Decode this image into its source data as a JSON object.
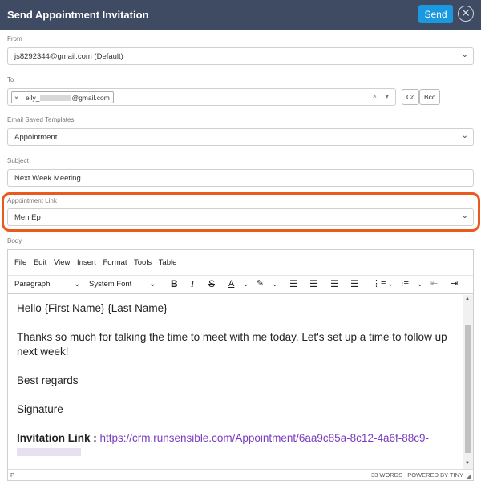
{
  "header": {
    "title": "Send Appointment Invitation",
    "send_label": "Send",
    "close_glyph": "✕"
  },
  "from": {
    "label": "From",
    "value": "js8292344@gmail.com (Default)"
  },
  "to": {
    "label": "To",
    "chip_remove": "×",
    "chip_prefix": "elly_",
    "chip_suffix": "@gmail.com",
    "clear_glyph": "×",
    "dropdown_glyph": "▾",
    "cc_label": "Cc",
    "bcc_label": "Bcc"
  },
  "templates": {
    "label": "Email Saved Templates",
    "value": "Appointment"
  },
  "subject": {
    "label": "Subject",
    "value": "Next Week Meeting"
  },
  "appointment_link": {
    "label": "Appointment Link",
    "value": "Men Ep"
  },
  "body": {
    "label": "Body",
    "menu": [
      "File",
      "Edit",
      "View",
      "Insert",
      "Format",
      "Tools",
      "Table"
    ],
    "toolbar": {
      "block_format": "Paragraph",
      "font_family": "System Font"
    },
    "content": {
      "greeting": "Hello {First Name} {Last Name}",
      "paragraph": "Thanks so much for talking the time to meet with me today. Let's set up a time to follow up next week!",
      "closing": "Best regards",
      "signature": "Signature",
      "invitation_label": "Invitation Link :",
      "invitation_url": "https://crm.runsensible.com/Appointment/6aa9c85a-8c12-4a6f-88c9-"
    },
    "status": {
      "path": "P",
      "word_count": "33 WORDS",
      "powered_by": "POWERED BY TINY"
    }
  },
  "colors": {
    "header_bg": "#3f4a63",
    "send_btn": "#1a98e0",
    "highlight": "#ea5a1e",
    "link": "#7a3cbf"
  },
  "icons": [
    "close-icon",
    "chevron-down-icon",
    "bold-icon",
    "italic-icon",
    "strikethrough-icon",
    "text-color-icon",
    "highlight-icon",
    "align-left-icon",
    "align-center-icon",
    "align-right-icon",
    "justify-icon",
    "numbered-list-icon",
    "bullet-list-icon",
    "outdent-icon",
    "indent-icon"
  ]
}
